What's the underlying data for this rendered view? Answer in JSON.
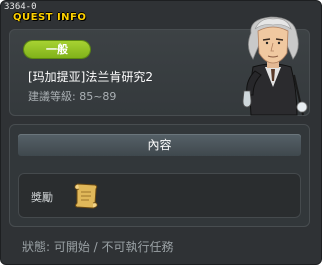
{
  "window": {
    "quest_id": "3364-0",
    "title": "QUEST INFO"
  },
  "quest": {
    "category": "一般",
    "name": "[玛加提亚]法兰肯研究2",
    "level_requirement": "建議等級: 85~89"
  },
  "content": {
    "header": "內容",
    "reward_label": "獎勵",
    "reward_icon": "scroll-icon"
  },
  "status": {
    "text": "狀態: 可開始 / 不可執行任務"
  },
  "colors": {
    "window_bg": "#2f3235",
    "title": "#ffd200",
    "category_pill": "#8fc21f",
    "content_header": "#4a545a"
  }
}
